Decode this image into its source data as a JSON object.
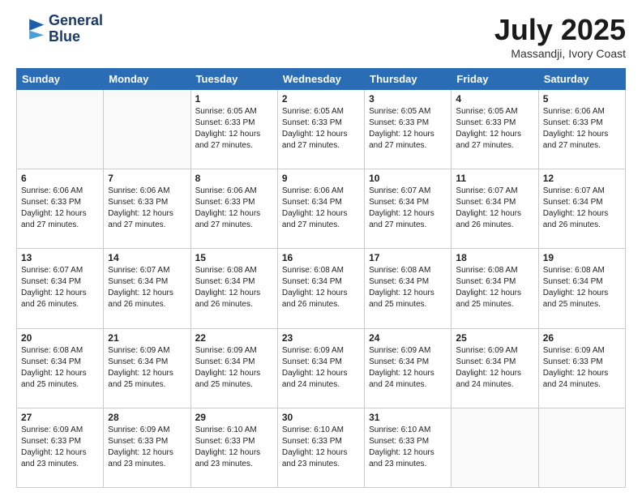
{
  "logo": {
    "line1": "General",
    "line2": "Blue"
  },
  "title": "July 2025",
  "subtitle": "Massandji, Ivory Coast",
  "weekdays": [
    "Sunday",
    "Monday",
    "Tuesday",
    "Wednesday",
    "Thursday",
    "Friday",
    "Saturday"
  ],
  "weeks": [
    [
      {
        "day": "",
        "info": ""
      },
      {
        "day": "",
        "info": ""
      },
      {
        "day": "1",
        "info": "Sunrise: 6:05 AM\nSunset: 6:33 PM\nDaylight: 12 hours and 27 minutes."
      },
      {
        "day": "2",
        "info": "Sunrise: 6:05 AM\nSunset: 6:33 PM\nDaylight: 12 hours and 27 minutes."
      },
      {
        "day": "3",
        "info": "Sunrise: 6:05 AM\nSunset: 6:33 PM\nDaylight: 12 hours and 27 minutes."
      },
      {
        "day": "4",
        "info": "Sunrise: 6:05 AM\nSunset: 6:33 PM\nDaylight: 12 hours and 27 minutes."
      },
      {
        "day": "5",
        "info": "Sunrise: 6:06 AM\nSunset: 6:33 PM\nDaylight: 12 hours and 27 minutes."
      }
    ],
    [
      {
        "day": "6",
        "info": "Sunrise: 6:06 AM\nSunset: 6:33 PM\nDaylight: 12 hours and 27 minutes."
      },
      {
        "day": "7",
        "info": "Sunrise: 6:06 AM\nSunset: 6:33 PM\nDaylight: 12 hours and 27 minutes."
      },
      {
        "day": "8",
        "info": "Sunrise: 6:06 AM\nSunset: 6:33 PM\nDaylight: 12 hours and 27 minutes."
      },
      {
        "day": "9",
        "info": "Sunrise: 6:06 AM\nSunset: 6:34 PM\nDaylight: 12 hours and 27 minutes."
      },
      {
        "day": "10",
        "info": "Sunrise: 6:07 AM\nSunset: 6:34 PM\nDaylight: 12 hours and 27 minutes."
      },
      {
        "day": "11",
        "info": "Sunrise: 6:07 AM\nSunset: 6:34 PM\nDaylight: 12 hours and 26 minutes."
      },
      {
        "day": "12",
        "info": "Sunrise: 6:07 AM\nSunset: 6:34 PM\nDaylight: 12 hours and 26 minutes."
      }
    ],
    [
      {
        "day": "13",
        "info": "Sunrise: 6:07 AM\nSunset: 6:34 PM\nDaylight: 12 hours and 26 minutes."
      },
      {
        "day": "14",
        "info": "Sunrise: 6:07 AM\nSunset: 6:34 PM\nDaylight: 12 hours and 26 minutes."
      },
      {
        "day": "15",
        "info": "Sunrise: 6:08 AM\nSunset: 6:34 PM\nDaylight: 12 hours and 26 minutes."
      },
      {
        "day": "16",
        "info": "Sunrise: 6:08 AM\nSunset: 6:34 PM\nDaylight: 12 hours and 26 minutes."
      },
      {
        "day": "17",
        "info": "Sunrise: 6:08 AM\nSunset: 6:34 PM\nDaylight: 12 hours and 25 minutes."
      },
      {
        "day": "18",
        "info": "Sunrise: 6:08 AM\nSunset: 6:34 PM\nDaylight: 12 hours and 25 minutes."
      },
      {
        "day": "19",
        "info": "Sunrise: 6:08 AM\nSunset: 6:34 PM\nDaylight: 12 hours and 25 minutes."
      }
    ],
    [
      {
        "day": "20",
        "info": "Sunrise: 6:08 AM\nSunset: 6:34 PM\nDaylight: 12 hours and 25 minutes."
      },
      {
        "day": "21",
        "info": "Sunrise: 6:09 AM\nSunset: 6:34 PM\nDaylight: 12 hours and 25 minutes."
      },
      {
        "day": "22",
        "info": "Sunrise: 6:09 AM\nSunset: 6:34 PM\nDaylight: 12 hours and 25 minutes."
      },
      {
        "day": "23",
        "info": "Sunrise: 6:09 AM\nSunset: 6:34 PM\nDaylight: 12 hours and 24 minutes."
      },
      {
        "day": "24",
        "info": "Sunrise: 6:09 AM\nSunset: 6:34 PM\nDaylight: 12 hours and 24 minutes."
      },
      {
        "day": "25",
        "info": "Sunrise: 6:09 AM\nSunset: 6:34 PM\nDaylight: 12 hours and 24 minutes."
      },
      {
        "day": "26",
        "info": "Sunrise: 6:09 AM\nSunset: 6:33 PM\nDaylight: 12 hours and 24 minutes."
      }
    ],
    [
      {
        "day": "27",
        "info": "Sunrise: 6:09 AM\nSunset: 6:33 PM\nDaylight: 12 hours and 23 minutes."
      },
      {
        "day": "28",
        "info": "Sunrise: 6:09 AM\nSunset: 6:33 PM\nDaylight: 12 hours and 23 minutes."
      },
      {
        "day": "29",
        "info": "Sunrise: 6:10 AM\nSunset: 6:33 PM\nDaylight: 12 hours and 23 minutes."
      },
      {
        "day": "30",
        "info": "Sunrise: 6:10 AM\nSunset: 6:33 PM\nDaylight: 12 hours and 23 minutes."
      },
      {
        "day": "31",
        "info": "Sunrise: 6:10 AM\nSunset: 6:33 PM\nDaylight: 12 hours and 23 minutes."
      },
      {
        "day": "",
        "info": ""
      },
      {
        "day": "",
        "info": ""
      }
    ]
  ]
}
